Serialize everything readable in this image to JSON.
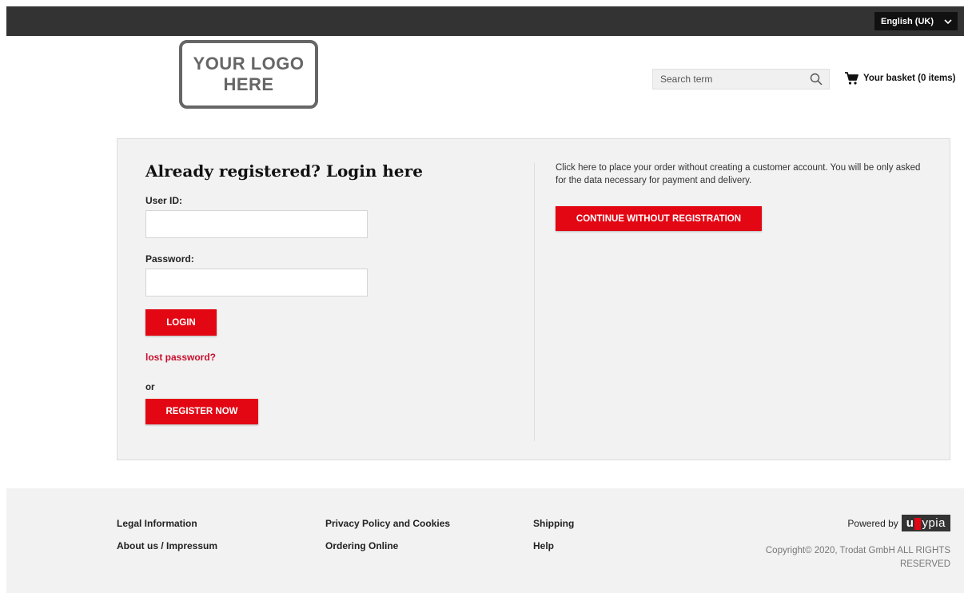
{
  "header": {
    "language": "English (UK)",
    "logo_lines": [
      "YOUR LOGO",
      "HERE"
    ],
    "search_placeholder": "Search term",
    "basket_label": "Your basket (0 items)"
  },
  "login": {
    "title": "Already registered? Login here",
    "userid_label": "User ID:",
    "userid_value": "",
    "password_label": "Password:",
    "password_value": "",
    "login_button": "LOGIN",
    "lost_password": "lost password?",
    "or_text": "or",
    "register_button": "REGISTER NOW"
  },
  "guest": {
    "text": "Click here to place your order without creating a customer account. You will be only asked for the data necessary for payment and delivery.",
    "continue_button": "CONTINUE WITHOUT REGISTRATION"
  },
  "footer": {
    "col1": [
      "Legal Information",
      "About us / Impressum"
    ],
    "col2": [
      "Privacy Policy and Cookies",
      "Ordering Online"
    ],
    "col3": [
      "Shipping",
      "Help"
    ],
    "powered_by": "Powered by",
    "utypia_brand": "uTypia",
    "copyright": "Copyright© 2020, Trodat GmbH ALL RIGHTS RESERVED"
  },
  "colors": {
    "accent": "#e30613",
    "topbar": "#333333",
    "panel_bg": "#f2f2f2"
  }
}
